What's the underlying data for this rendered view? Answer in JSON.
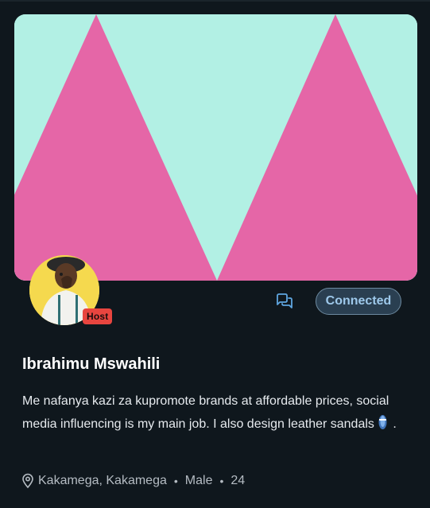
{
  "profile": {
    "name": "Ibrahimu Mswahili",
    "role_badge": "Host",
    "bio_text": "Me nafanya kazi za kupromote brands at affordable prices, social media influencing is my main job. I also design leather sandals",
    "bio_end": ".",
    "bio_emoji": "sandal-icon",
    "location": "Kakamega, Kakamega",
    "gender": "Male",
    "age": "24",
    "separator": "•"
  },
  "actions": {
    "message_icon": "chat-bubbles-icon",
    "connect_label": "Connected"
  },
  "cover": {
    "background_color": "#b2f0e4",
    "triangle_color": "#e566a7"
  },
  "colors": {
    "page_bg": "#0f171d",
    "badge_bg": "#e8453f",
    "button_bg": "#2a3f51",
    "button_text": "#9ec9eb",
    "icon_accent": "#5fa6e0"
  }
}
